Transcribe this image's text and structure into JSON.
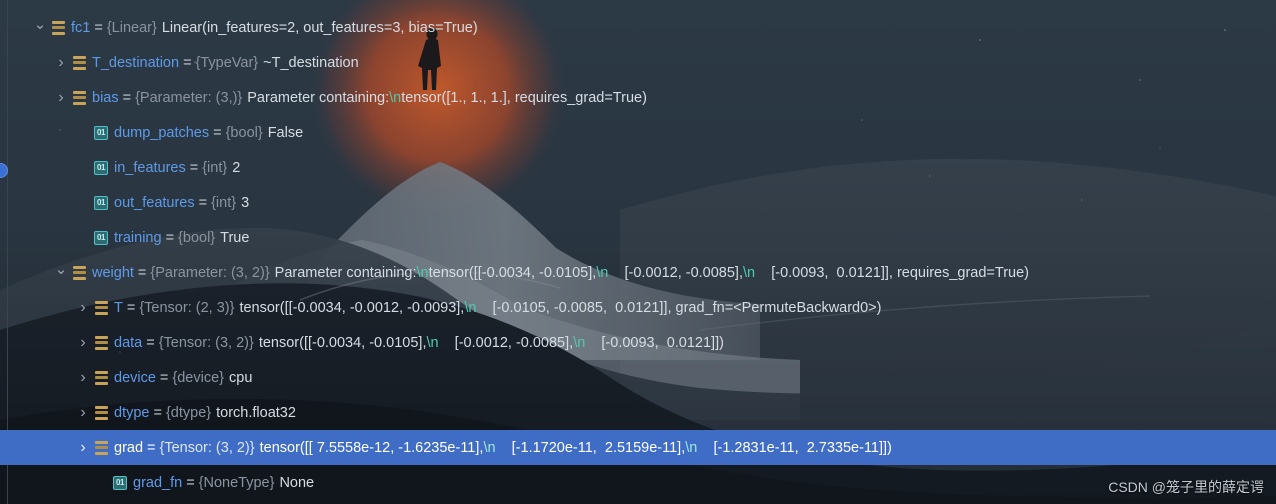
{
  "panel": {
    "name": "debugger-variables-tree",
    "watermark": "CSDN @笼子里的薛定谔",
    "colors": {
      "selection": "#3f6cc4",
      "variable_name": "#5f9ae8",
      "type_hint": "#8a94a0",
      "value_text": "#d6dce3",
      "escape_seq": "#4ec9b0",
      "object_icon": "#c8a45a",
      "primitive_icon": "#4cc2c6",
      "background": "#232c38"
    },
    "rows": [
      {
        "id": "fc1",
        "indent": 0,
        "twisty": "open",
        "icon": "object-icon",
        "name": "fc1",
        "eq": "=",
        "type": "{Linear}",
        "value": "Linear(in_features=2, out_features=3, bias=True)",
        "selected": false
      },
      {
        "id": "T_destination",
        "indent": 1,
        "twisty": "closed",
        "icon": "object-icon",
        "name": "T_destination",
        "eq": "=",
        "type": "{TypeVar}",
        "value": "~T_destination",
        "selected": false
      },
      {
        "id": "bias",
        "indent": 1,
        "twisty": "closed",
        "icon": "object-icon",
        "name": "bias",
        "eq": "=",
        "type": "{Parameter: (3,)}",
        "value_pre": "Parameter containing:",
        "esc1": "\\n",
        "value_post": "tensor([1., 1., 1.], requires_grad=True)",
        "selected": false
      },
      {
        "id": "dump_patches",
        "indent": 2,
        "twisty": "blank",
        "icon": "primitive-icon",
        "name": "dump_patches",
        "eq": "=",
        "type": "{bool}",
        "value": "False",
        "selected": false
      },
      {
        "id": "in_features",
        "indent": 2,
        "twisty": "blank",
        "icon": "primitive-icon",
        "name": "in_features",
        "eq": "=",
        "type": "{int}",
        "value": "2",
        "selected": false
      },
      {
        "id": "out_features",
        "indent": 2,
        "twisty": "blank",
        "icon": "primitive-icon",
        "name": "out_features",
        "eq": "=",
        "type": "{int}",
        "value": "3",
        "selected": false
      },
      {
        "id": "training",
        "indent": 2,
        "twisty": "blank",
        "icon": "primitive-icon",
        "name": "training",
        "eq": "=",
        "type": "{bool}",
        "value": "True",
        "selected": false
      },
      {
        "id": "weight",
        "indent": 1,
        "twisty": "open",
        "icon": "object-icon",
        "name": "weight",
        "eq": "=",
        "type": "{Parameter: (3, 2)}",
        "value_pre": "Parameter containing:",
        "esc1": "\\n",
        "value_mid1": "tensor([[-0.0034, -0.0105],",
        "esc2": "\\n",
        "value_mid2": "    [-0.0012, -0.0085],",
        "esc3": "\\n",
        "value_post": "    [-0.0093,  0.0121]], requires_grad=True)",
        "selected": false
      },
      {
        "id": "T",
        "indent": 2,
        "twisty": "closed",
        "icon": "object-icon",
        "name": "T",
        "eq": "=",
        "type": "{Tensor: (2, 3)}",
        "value_pre": "tensor([[-0.0034, -0.0012, -0.0093],",
        "esc1": "\\n",
        "value_post": "    [-0.0105, -0.0085,  0.0121]], grad_fn=<PermuteBackward0>)",
        "selected": false
      },
      {
        "id": "data",
        "indent": 2,
        "twisty": "closed",
        "icon": "object-icon",
        "name": "data",
        "eq": "=",
        "type": "{Tensor: (3, 2)}",
        "value_pre": "tensor([[-0.0034, -0.0105],",
        "esc1": "\\n",
        "value_mid1": "    [-0.0012, -0.0085],",
        "esc2": "\\n",
        "value_post": "    [-0.0093,  0.0121]])",
        "selected": false
      },
      {
        "id": "device",
        "indent": 2,
        "twisty": "closed",
        "icon": "object-icon",
        "name": "device",
        "eq": "=",
        "type": "{device}",
        "value": "cpu",
        "selected": false
      },
      {
        "id": "dtype",
        "indent": 2,
        "twisty": "closed",
        "icon": "object-icon",
        "name": "dtype",
        "eq": "=",
        "type": "{dtype}",
        "value": "torch.float32",
        "selected": false
      },
      {
        "id": "grad",
        "indent": 2,
        "twisty": "closed",
        "icon": "object-icon",
        "name": "grad",
        "eq": "=",
        "type": "{Tensor: (3, 2)}",
        "value_pre": "tensor([[ 7.5558e-12, -1.6235e-11],",
        "esc1": "\\n",
        "value_mid1": "    [-1.1720e-11,  2.5159e-11],",
        "esc2": "\\n",
        "value_post": "    [-1.2831e-11,  2.7335e-11]])",
        "selected": true
      },
      {
        "id": "grad_fn",
        "indent": 3,
        "twisty": "blank",
        "icon": "primitive-icon",
        "name": "grad_fn",
        "eq": "=",
        "type": "{NoneType}",
        "value": "None",
        "selected": false
      }
    ]
  }
}
